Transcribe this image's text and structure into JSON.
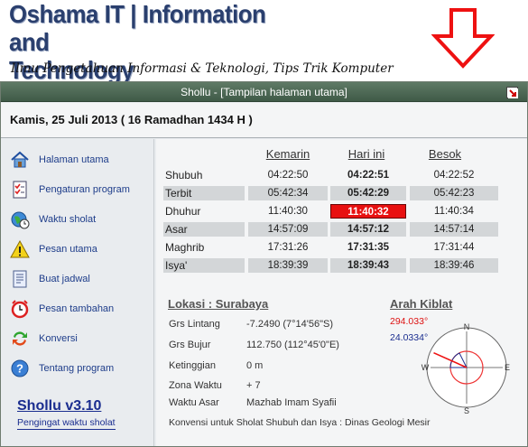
{
  "blog": {
    "title_line1": "Oshama IT | Information and",
    "title_line2": "Technology",
    "tagline": "Ilmu Pengetahuan Informasi & Teknologi, Tips Trik Komputer"
  },
  "window": {
    "title": "Shollu - [Tampilan halaman utama]"
  },
  "date": "Kamis, 25 Juli 2013 ( 16 Ramadhan 1434 H )",
  "sidebar": {
    "items": [
      {
        "label": "Halaman utama",
        "icon": "home-icon"
      },
      {
        "label": "Pengaturan program",
        "icon": "checklist-icon"
      },
      {
        "label": "Waktu sholat",
        "icon": "globe-clock-icon"
      },
      {
        "label": "Pesan utama",
        "icon": "warning-icon"
      },
      {
        "label": "Buat jadwal",
        "icon": "document-icon"
      },
      {
        "label": "Pesan tambahan",
        "icon": "alarm-clock-icon"
      },
      {
        "label": "Konversi",
        "icon": "convert-icon"
      },
      {
        "label": "Tentang program",
        "icon": "help-icon"
      }
    ],
    "app_name": "Shollu v3.10",
    "app_subtitle": "Pengingat waktu sholat"
  },
  "schedule": {
    "columns": [
      "Kemarin",
      "Hari ini",
      "Besok"
    ],
    "rows": [
      {
        "name": "Shubuh",
        "kemarin": "04:22:50",
        "hari_ini": "04:22:51",
        "besok": "04:22:52"
      },
      {
        "name": "Terbit",
        "kemarin": "05:42:34",
        "hari_ini": "05:42:29",
        "besok": "05:42:23"
      },
      {
        "name": "Dhuhur",
        "kemarin": "11:40:30",
        "hari_ini": "11:40:32",
        "besok": "11:40:34"
      },
      {
        "name": "Asar",
        "kemarin": "14:57:09",
        "hari_ini": "14:57:12",
        "besok": "14:57:14"
      },
      {
        "name": "Maghrib",
        "kemarin": "17:31:26",
        "hari_ini": "17:31:35",
        "besok": "17:31:44"
      },
      {
        "name": "Isya'",
        "kemarin": "18:39:39",
        "hari_ini": "18:39:43",
        "besok": "18:39:46"
      }
    ],
    "highlight_row": 2
  },
  "location": {
    "heading": "Lokasi :  Surabaya",
    "details": [
      {
        "label": "Grs Lintang",
        "value": "-7.2490 (7°14'56\"S)"
      },
      {
        "label": "Grs Bujur",
        "value": "112.750 (112°45'0\"E)"
      },
      {
        "label": "Ketinggian",
        "value": "0 m"
      },
      {
        "label": "Zona Waktu",
        "value": "+ 7"
      },
      {
        "label": "Waktu Asar",
        "value": "Mazhab Imam Syafii"
      }
    ],
    "footnote": "Konvensi untuk Sholat Shubuh dan Isya : Dinas Geologi Mesir"
  },
  "kiblat": {
    "heading": "Arah Kiblat",
    "angle_red": "294.033°",
    "angle_blue": "24.0334°",
    "compass": {
      "n": "N",
      "e": "E",
      "s": "S",
      "w": "W",
      "direction_deg": 294.033
    }
  },
  "colors": {
    "titlebar": "#4f6a57",
    "link_blue": "#1e3d8a",
    "highlight": "#e81010",
    "kiblat_red": "#dd1111"
  }
}
